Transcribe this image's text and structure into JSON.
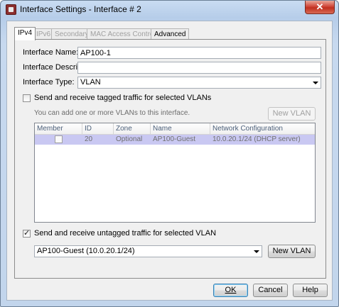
{
  "window": {
    "title": "Interface Settings - Interface # 2",
    "close_glyph": "✕"
  },
  "tabs": [
    {
      "label": "IPv4",
      "state": "active"
    },
    {
      "label": "IPv6",
      "state": "disabled"
    },
    {
      "label": "Secondary",
      "state": "disabled"
    },
    {
      "label": "MAC Access Control",
      "state": "disabled"
    },
    {
      "label": "Advanced",
      "state": "enabled"
    }
  ],
  "form": {
    "name_label": "Interface Name:",
    "name_value": "AP100-1",
    "description_label": "Interface Description:",
    "description_value": "",
    "type_label": "Interface Type:",
    "type_value": "VLAN"
  },
  "tagged": {
    "checkbox_label": "Send and receive tagged traffic for selected VLANs",
    "checked": false,
    "hint": "You can add one or more VLANs to this interface.",
    "new_vlan_label": "New VLAN"
  },
  "vlan_table": {
    "columns": [
      "Member",
      "ID",
      "Zone",
      "Name",
      "Network Configuration"
    ],
    "rows": [
      {
        "member": false,
        "id": "20",
        "zone": "Optional",
        "name": "AP100-Guest",
        "network": "10.0.20.1/24 (DHCP server)"
      }
    ]
  },
  "untagged": {
    "checkbox_label": "Send and receive untagged traffic for selected VLAN",
    "checked": true,
    "selected_vlan": "AP100-Guest (10.0.20.1/24)",
    "new_vlan_label": "New VLAN"
  },
  "buttons": {
    "ok": "OK",
    "cancel": "Cancel",
    "help": "Help"
  }
}
